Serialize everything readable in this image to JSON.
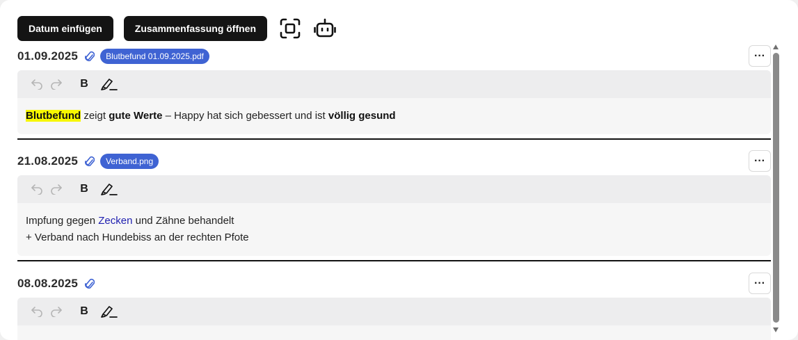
{
  "toolbar": {
    "insert_date_label": "Datum einfügen",
    "open_summary_label": "Zusammenfassung öffnen",
    "scan_icon": "scan-frame-icon",
    "bot_icon": "robot-icon"
  },
  "entries": [
    {
      "date": "01.09.2025",
      "attachment": "Blutbefund 01.09.2025.pdf",
      "segments": {
        "s1": "Blutbefund",
        "s2": " zeigt ",
        "s3": "gute Werte",
        "s4": " – Happy hat sich gebessert und ist ",
        "s5": "völlig gesund"
      }
    },
    {
      "date": "21.08.2025",
      "attachment": "Verband.png",
      "segments": {
        "l1a": "Impfung gegen ",
        "l1b": "Zecken",
        "l1c": " und Zähne behandelt",
        "l2": "+ Verband nach Hundebiss an der rechten Pfote"
      }
    },
    {
      "date": "08.08.2025",
      "attachment": ""
    }
  ],
  "editor_toolbar": {
    "bold_label": "B",
    "undo_icon": "undo-icon",
    "redo_icon": "redo-icon",
    "highlight_icon": "highlighter-icon"
  },
  "more_label": "···",
  "colors": {
    "button_dark": "#141414",
    "tag_blue": "#3f63d3",
    "highlight": "#f7f700",
    "link": "#2020b0"
  }
}
